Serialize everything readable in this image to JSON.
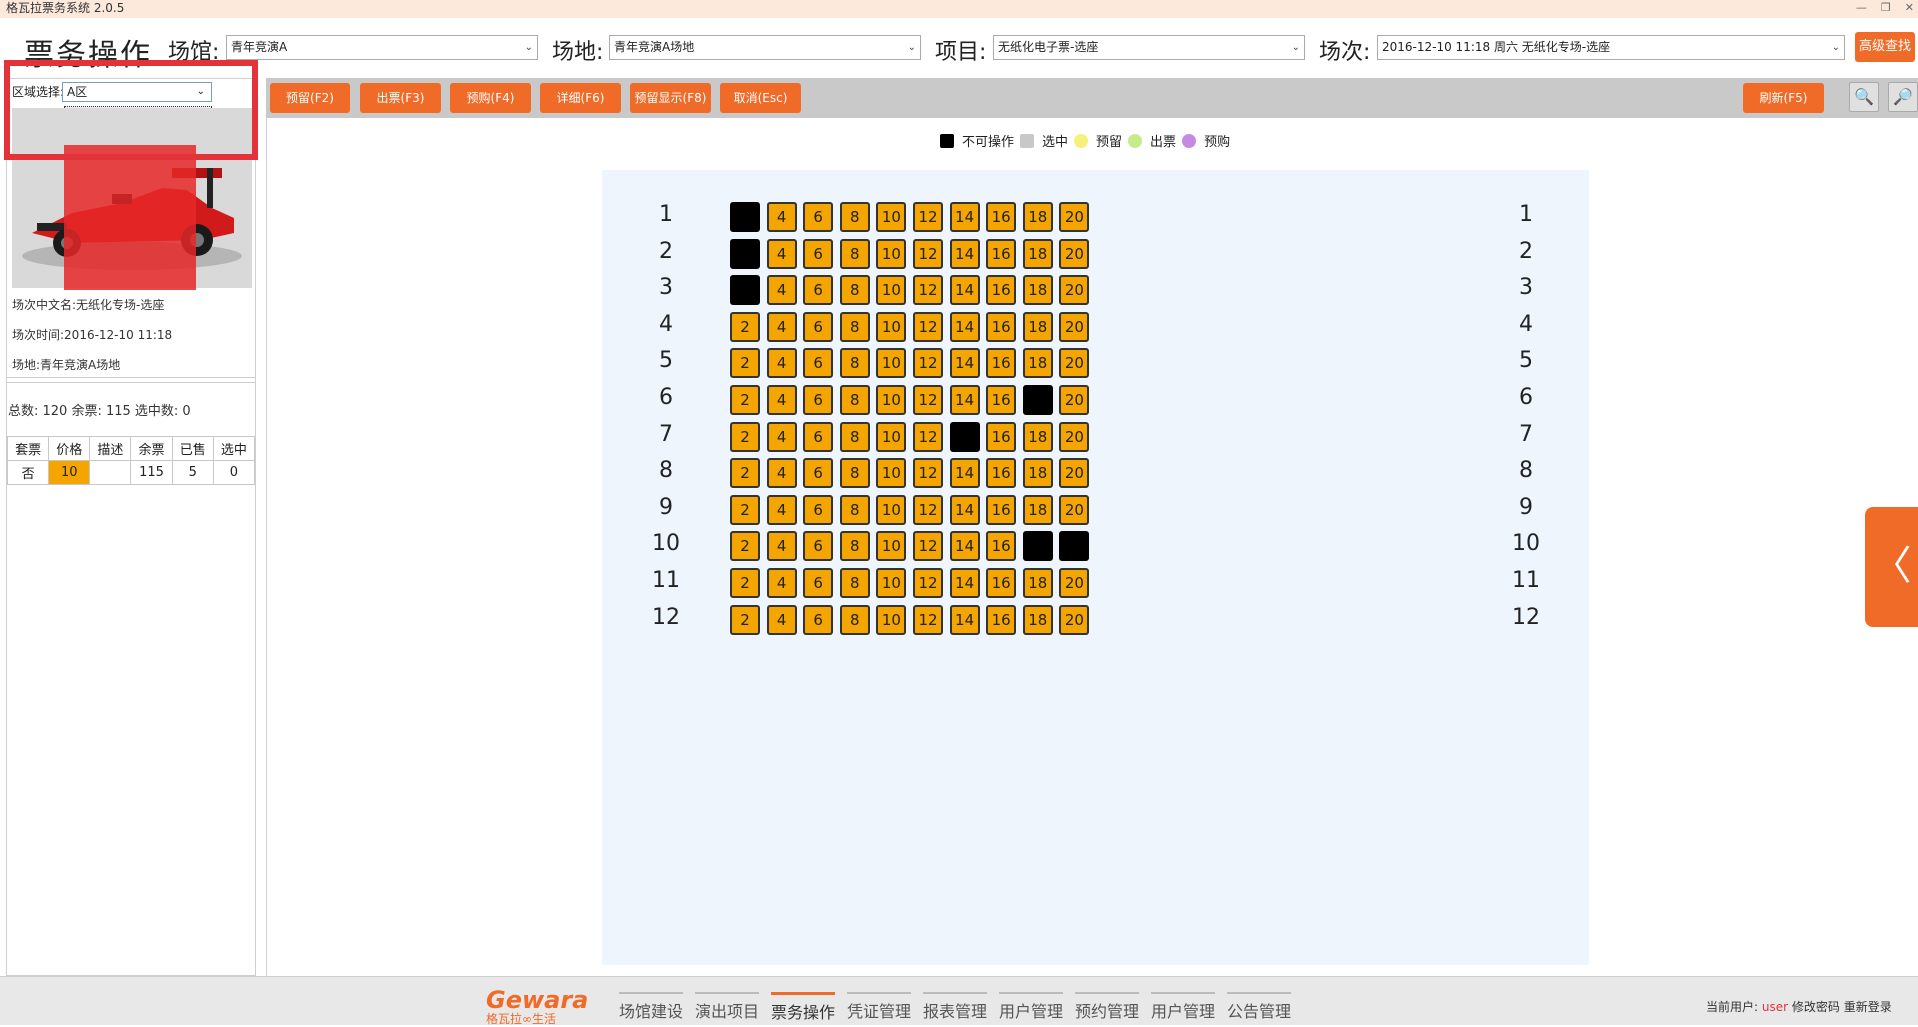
{
  "app_title": "格瓦拉票务系统 2.0.5",
  "page_title": "票务操作",
  "filters": {
    "venue_label": "场馆:",
    "venue_value": "青年竞演A",
    "site_label": "场地:",
    "site_value": "青年竞演A场地",
    "project_label": "项目:",
    "project_value": "无纸化电子票-选座",
    "session_label": "场次:",
    "session_value": "2016-12-10 11:18 周六 无纸化专场-选座",
    "advanced_search": "高级查找"
  },
  "region": {
    "label": "区域选择:",
    "value": "A区",
    "options": [
      "A区"
    ]
  },
  "session_info": {
    "name": "场次中文名:无纸化专场-选座",
    "time": "场次时间:2016-12-10 11:18",
    "site": "场地:青年竞演A场地"
  },
  "summary": "总数: 120 余票: 115 选中数: 0",
  "price_table": {
    "headers": [
      "套票",
      "价格",
      "描述",
      "余票",
      "已售",
      "选中"
    ],
    "row": [
      "否",
      "10",
      "",
      "115",
      "5",
      "0"
    ]
  },
  "toolbar": {
    "reserve": "预留(F2)",
    "sell": "出票(F3)",
    "presale": "预购(F4)",
    "detail": "详细(F6)",
    "reserve_show": "预留显示(F8)",
    "cancel": "取消(Esc)",
    "refresh": "刷新(F5)"
  },
  "legend": [
    {
      "label": "不可操作",
      "color": "#000000",
      "shape": "square"
    },
    {
      "label": "选中",
      "color": "#c8c8c8",
      "shape": "square"
    },
    {
      "label": "预留",
      "color": "#f7f07a",
      "shape": "circle"
    },
    {
      "label": "出票",
      "color": "#c6ec8a",
      "shape": "circle"
    },
    {
      "label": "预购",
      "color": "#c58be0",
      "shape": "circle"
    }
  ],
  "seat_map": {
    "rows": [
      1,
      2,
      3,
      4,
      5,
      6,
      7,
      8,
      9,
      10,
      11,
      12
    ],
    "seat_numbers": [
      2,
      4,
      6,
      8,
      10,
      12,
      14,
      16,
      18,
      20
    ],
    "blocked": [
      {
        "row": 1,
        "seat": 2
      },
      {
        "row": 2,
        "seat": 2
      },
      {
        "row": 3,
        "seat": 2
      },
      {
        "row": 6,
        "seat": 18
      },
      {
        "row": 7,
        "seat": 14
      },
      {
        "row": 10,
        "seat": 18
      },
      {
        "row": 10,
        "seat": 20
      }
    ]
  },
  "colors": {
    "accent": "#f06a28",
    "seat_available": "#f5a500",
    "seat_blocked": "#000000",
    "highlight_frame": "#e3323a"
  },
  "footer": {
    "brand": "Gewara",
    "brand_sub": "格瓦拉∞生活",
    "nav": [
      "场馆建设",
      "演出项目",
      "票务操作",
      "凭证管理",
      "报表管理",
      "用户管理",
      "预约管理",
      "用户管理",
      "公告管理"
    ],
    "active_index": 2,
    "user_prefix": "当前用户:",
    "user_name": "user",
    "change_password": "修改密码",
    "relogin": "重新登录"
  }
}
